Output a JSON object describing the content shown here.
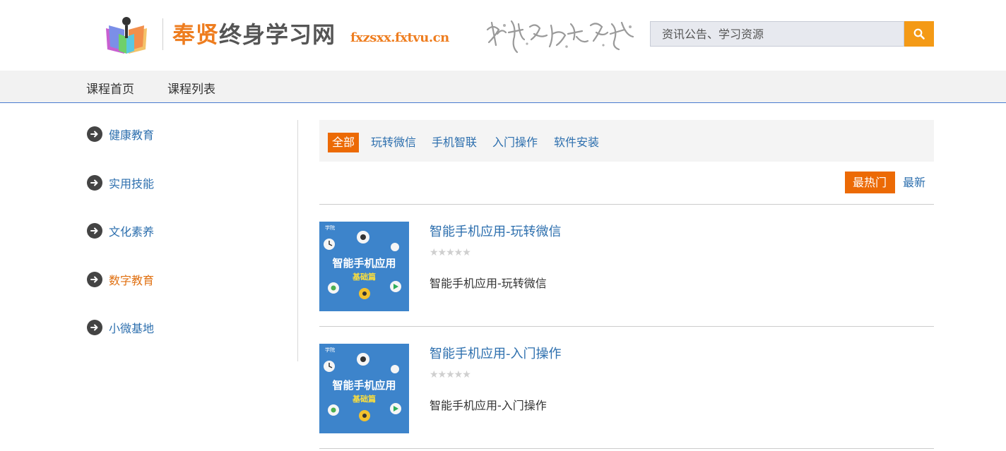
{
  "header": {
    "site_name_part1": "奉贤",
    "site_name_part2": "终身学习网",
    "site_url": "fxzsxx.fxtvu.cn",
    "search_placeholder": "资讯公告、学习资源"
  },
  "nav": {
    "items": [
      {
        "label": "课程首页"
      },
      {
        "label": "课程列表"
      }
    ]
  },
  "sidebar": {
    "items": [
      {
        "label": "健康教育",
        "active": false
      },
      {
        "label": "实用技能",
        "active": false
      },
      {
        "label": "文化素养",
        "active": false
      },
      {
        "label": "数字教育",
        "active": true
      },
      {
        "label": "小微基地",
        "active": false
      }
    ]
  },
  "filters": {
    "items": [
      {
        "label": "全部",
        "active": true
      },
      {
        "label": "玩转微信",
        "active": false
      },
      {
        "label": "手机智联",
        "active": false
      },
      {
        "label": "入门操作",
        "active": false
      },
      {
        "label": "软件安装",
        "active": false
      }
    ]
  },
  "sort": {
    "hot_label": "最热门",
    "new_label": "最新"
  },
  "courses": [
    {
      "title": "智能手机应用-玩转微信",
      "rating_stars": "★★★★★",
      "description": "智能手机应用-玩转微信",
      "thumb_title": "智能手机应用",
      "thumb_subtitle": "基础篇",
      "thumb_corner": "学院"
    },
    {
      "title": "智能手机应用-入门操作",
      "rating_stars": "★★★★★",
      "description": "智能手机应用-入门操作",
      "thumb_title": "智能手机应用",
      "thumb_subtitle": "基础篇",
      "thumb_corner": "学院"
    }
  ],
  "colors": {
    "accent_orange": "#ec6a05",
    "link_blue": "#2d6fae",
    "search_button": "#f49a16"
  }
}
